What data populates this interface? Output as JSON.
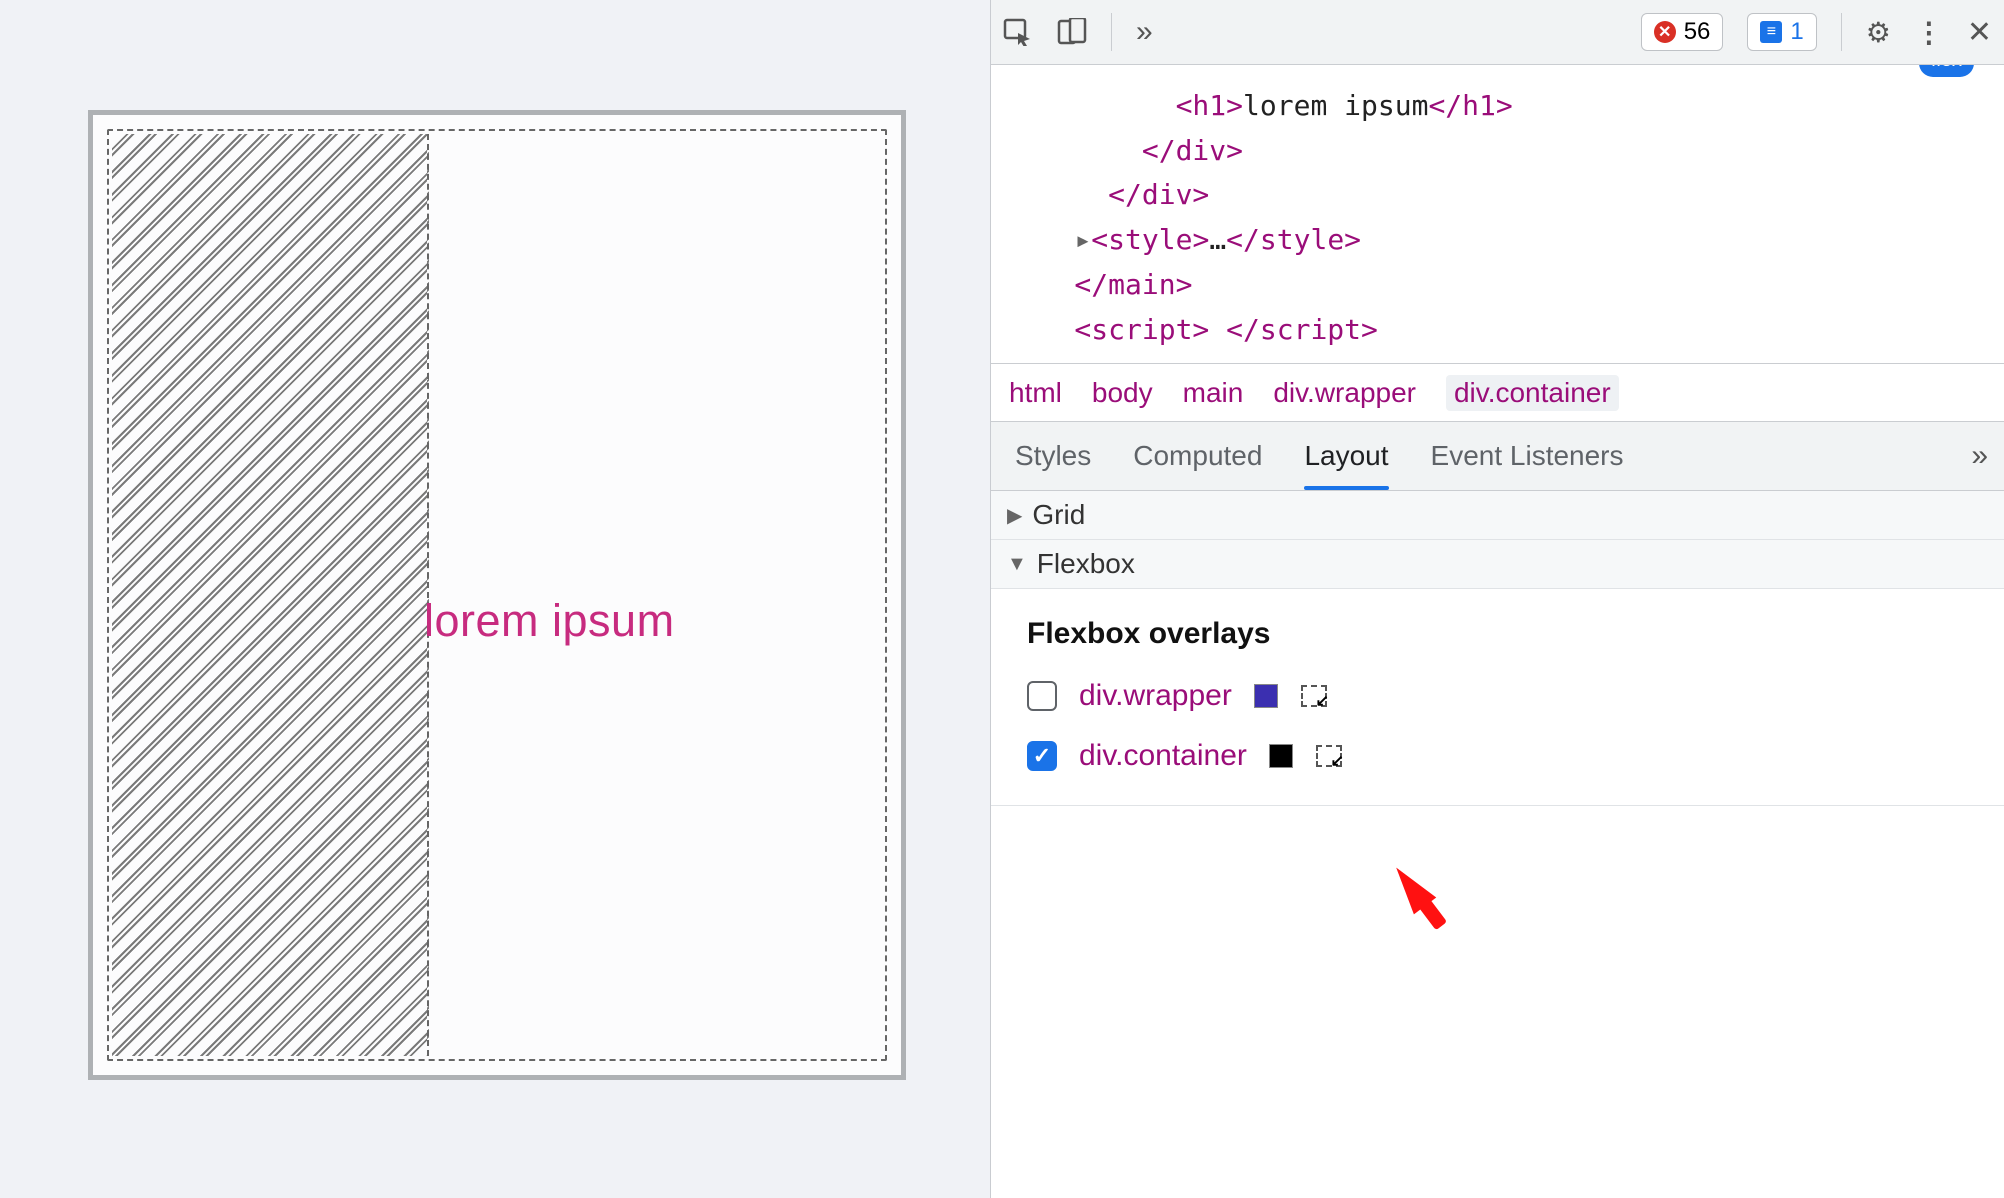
{
  "viewport": {
    "heading_text": "lorem ipsum"
  },
  "toolbar": {
    "errors_count": "56",
    "messages_count": "1"
  },
  "dom": {
    "line0_prefix": "          ",
    "line0_open": "<h1>",
    "line0_text": "lorem ipsum",
    "line0_close": "</h1>",
    "line1": "        </div>",
    "line2": "      </div>",
    "line3_prefix": "    ",
    "line3_open": "<style>",
    "line3_ellipsis": "…",
    "line3_close": "</style>",
    "line4": "    </main>",
    "line5": "    <script> </",
    "line5b": "script>",
    "flex_badge": "flex"
  },
  "breadcrumb": {
    "items": [
      "html",
      "body",
      "main",
      "div.wrapper",
      "div.container"
    ],
    "selected_index": 4
  },
  "subtabs": {
    "items": [
      "Styles",
      "Computed",
      "Layout",
      "Event Listeners"
    ],
    "active_index": 2
  },
  "layout_sections": {
    "grid_label": "Grid",
    "flexbox_label": "Flexbox",
    "overlays_title": "Flexbox overlays",
    "overlays": [
      {
        "checked": false,
        "name": "div.wrapper",
        "swatch": "purple"
      },
      {
        "checked": true,
        "name": "div.container",
        "swatch": "black"
      }
    ]
  }
}
